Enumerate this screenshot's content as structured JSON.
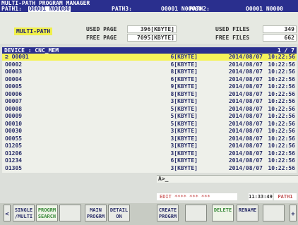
{
  "title": {
    "app_name": "MULTI-PATH PROGRAM MANAGER",
    "path1_label": "PATH1:",
    "path1_value": "O0001 N00000",
    "path3_label": "PATH3:",
    "path3_value": "O0001 N00000",
    "path2_label": "PATH2:",
    "path2_value": "O0001 N0000"
  },
  "info": {
    "mode_label": "MULTI-PATH",
    "used_page_label": "USED PAGE",
    "used_page_value": "396[KBYTE]",
    "free_page_label": "FREE PAGE",
    "free_page_value": "7095[KBYTE]",
    "used_files_label": "USED FILES",
    "used_files_value": "349",
    "free_files_label": "FREE FILES",
    "free_files_value": "662"
  },
  "device": {
    "label": "DEVICE : CNC_MEM",
    "page": "1 / 7"
  },
  "files": [
    {
      "name": "O0001",
      "size": "6[KBYTE]",
      "date": "2014/08/07",
      "time": "10:22:56",
      "selected": true,
      "marker": "⊇"
    },
    {
      "name": "O0002",
      "size": "6[KBYTE]",
      "date": "2014/08/07",
      "time": "10:22:56"
    },
    {
      "name": "O0003",
      "size": "8[KBYTE]",
      "date": "2014/08/07",
      "time": "10:22:56"
    },
    {
      "name": "O0004",
      "size": "6[KBYTE]",
      "date": "2014/08/07",
      "time": "10:22:56"
    },
    {
      "name": "O0005",
      "size": "9[KBYTE]",
      "date": "2014/08/07",
      "time": "10:22:56"
    },
    {
      "name": "O0006",
      "size": "8[KBYTE]",
      "date": "2014/08/07",
      "time": "10:22:56"
    },
    {
      "name": "O0007",
      "size": "3[KBYTE]",
      "date": "2014/08/07",
      "time": "10:22:56"
    },
    {
      "name": "O0008",
      "size": "5[KBYTE]",
      "date": "2014/08/07",
      "time": "10:22:56"
    },
    {
      "name": "O0009",
      "size": "5[KBYTE]",
      "date": "2014/08/07",
      "time": "10:22:56"
    },
    {
      "name": "O0010",
      "size": "5[KBYTE]",
      "date": "2014/08/07",
      "time": "10:22:56"
    },
    {
      "name": "O0030",
      "size": "3[KBYTE]",
      "date": "2014/08/07",
      "time": "10:22:56"
    },
    {
      "name": "O0055",
      "size": "3[KBYTE]",
      "date": "2014/08/07",
      "time": "10:22:56"
    },
    {
      "name": "O1205",
      "size": "3[KBYTE]",
      "date": "2014/08/07",
      "time": "10:22:56"
    },
    {
      "name": "O1206",
      "size": "3[KBYTE]",
      "date": "2014/08/07",
      "time": "10:22:56"
    },
    {
      "name": "O1234",
      "size": "6[KBYTE]",
      "date": "2014/08/07",
      "time": "10:22:56"
    },
    {
      "name": "O1305",
      "size": "3[KBYTE]",
      "date": "2014/08/07",
      "time": "10:22:56"
    }
  ],
  "input": {
    "prompt": "A>_"
  },
  "status": {
    "mode": "EDIT **** *** ***",
    "time": "11:33:49",
    "path": "PATH1"
  },
  "softkeys": [
    {
      "label": "<",
      "kind": "arrow"
    },
    {
      "label": "SINGLE\n/MULTI",
      "kind": "normal"
    },
    {
      "label": "PROGRM\nSEARCH",
      "kind": "hl"
    },
    {
      "label": "",
      "kind": "normal"
    },
    {
      "label": "MAIN\nPROGRM",
      "kind": "normal"
    },
    {
      "label": "DETAIL\nON",
      "kind": "normal"
    },
    {
      "label": "CREATE\nPROGRM",
      "kind": "normal"
    },
    {
      "label": "",
      "kind": "normal"
    },
    {
      "label": "DELETE",
      "kind": "hl"
    },
    {
      "label": "RENAME",
      "kind": "normal"
    },
    {
      "label": "",
      "kind": "normal"
    },
    {
      "label": "+",
      "kind": "arrow"
    }
  ]
}
